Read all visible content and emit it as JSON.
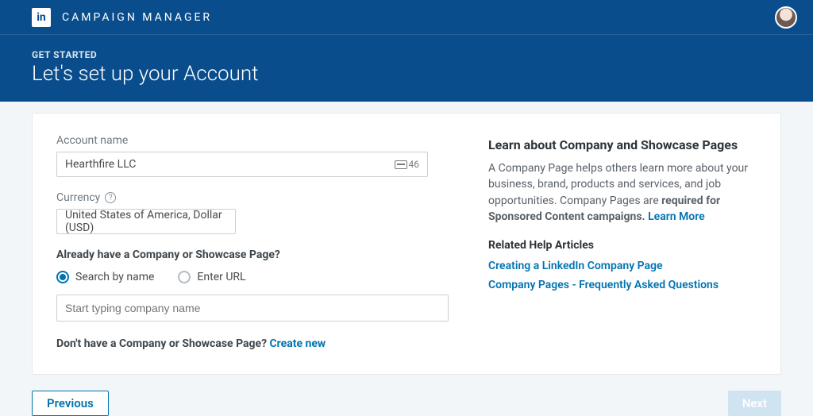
{
  "header": {
    "logo_text": "in",
    "app_title": "CAMPAIGN MANAGER"
  },
  "hero": {
    "kicker": "GET STARTED",
    "title": "Let's set up your Account"
  },
  "form": {
    "account_name_label": "Account name",
    "account_name_value": "Hearthfire LLC",
    "account_name_suffix": "46",
    "currency_label": "Currency",
    "currency_value": "United States of America, Dollar (USD)",
    "showcase_question": "Already have a Company or Showcase Page?",
    "radio_search": "Search by name",
    "radio_url": "Enter URL",
    "search_placeholder": "Start typing company name",
    "no_company_text": "Don't have a Company or Showcase Page? ",
    "create_new": "Create new"
  },
  "sidebar": {
    "title": "Learn about Company and Showcase Pages",
    "body_a": "A Company Page helps others learn more about your business, brand, products and services, and job opportunities. Company Pages are ",
    "body_bold": "required for Sponsored Content campaigns. ",
    "learn_more": "Learn More",
    "related_title": "Related Help Articles",
    "link1": "Creating a LinkedIn Company Page",
    "link2": "Company Pages - Frequently Asked Questions"
  },
  "footer": {
    "prev": "Previous",
    "next": "Next"
  }
}
